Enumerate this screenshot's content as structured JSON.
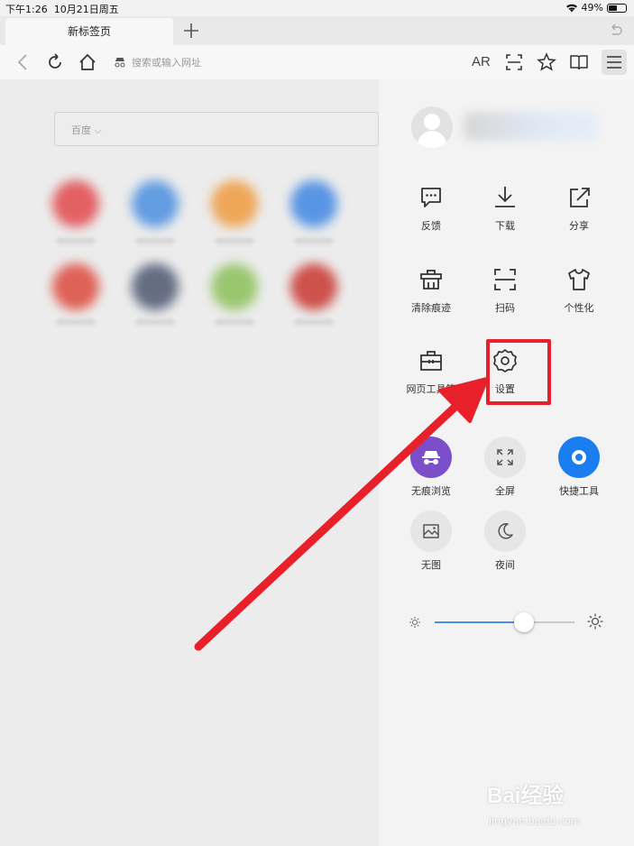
{
  "status_bar": {
    "time": "下午1:26",
    "date": "10月21日周五",
    "battery": "49%",
    "battery_level": 0.49
  },
  "tab_bar": {
    "active_tab": "新标签页"
  },
  "toolbar": {
    "address_placeholder": "搜索或输入网址",
    "ar_label": "AR"
  },
  "page": {
    "search_engine": "百度"
  },
  "menu": {
    "rows": [
      [
        {
          "label": "反馈",
          "icon": "feedback-icon"
        },
        {
          "label": "下载",
          "icon": "download-icon"
        },
        {
          "label": "分享",
          "icon": "share-icon"
        }
      ],
      [
        {
          "label": "清除痕迹",
          "icon": "clear-traces-icon"
        },
        {
          "label": "扫码",
          "icon": "scan-icon"
        },
        {
          "label": "个性化",
          "icon": "tshirt-icon"
        }
      ],
      [
        {
          "label": "网页工具箱",
          "icon": "toolbox-icon"
        },
        {
          "label": "设置",
          "icon": "gear-icon"
        }
      ]
    ],
    "toggles": [
      {
        "label": "无痕浏览",
        "icon": "incognito-icon",
        "active": true,
        "color": "#7a4fc9"
      },
      {
        "label": "全屏",
        "icon": "fullscreen-icon",
        "active": false
      },
      {
        "label": "快捷工具",
        "icon": "quick-tools-icon",
        "active": true,
        "color": "#1a7ef0"
      },
      {
        "label": "无图",
        "icon": "no-image-icon",
        "active": false
      },
      {
        "label": "夜间",
        "icon": "moon-icon",
        "active": false
      }
    ],
    "brightness": 0.64
  },
  "annotation": {
    "color": "#e8202a",
    "target": "设置"
  },
  "watermark": {
    "brand": "Bai经验",
    "url": "jingyan.baidu.com"
  }
}
